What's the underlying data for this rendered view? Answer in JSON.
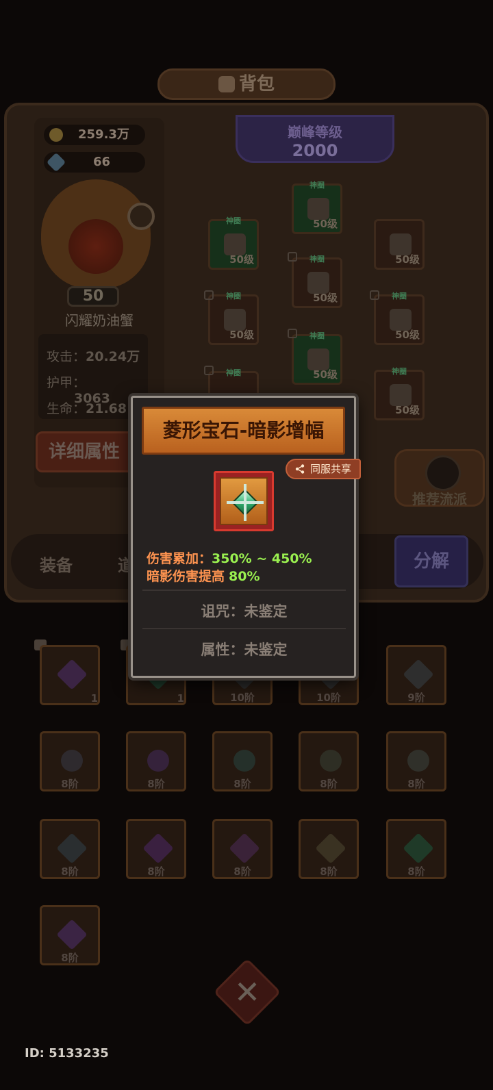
{
  "header": {
    "title": "背包"
  },
  "player": {
    "gold": "259.3万",
    "gems": "66",
    "level": "50",
    "name": "闪耀奶油蟹",
    "stats": [
      {
        "label": "攻击：",
        "value": "20.24万"
      },
      {
        "label": "护甲：",
        "value": "3063"
      },
      {
        "label": "生命：",
        "value": "21.68"
      }
    ],
    "detail_button": "详细属性"
  },
  "peak": {
    "label": "巅峰等级",
    "value": "2000"
  },
  "equipment": [
    {
      "tag": "神圈",
      "level": "50级",
      "green": true
    },
    {
      "tag": "神圈",
      "level": "50级",
      "green": true
    },
    {
      "tag": "",
      "level": "50级",
      "green": false
    },
    {
      "tag": "神圈",
      "level": "50级",
      "green": false
    },
    {
      "tag": "神圈",
      "level": "50级",
      "green": false
    },
    {
      "tag": "神圈",
      "level": "50级",
      "green": false
    },
    {
      "tag": "神圈",
      "level": "50级",
      "green": true
    },
    {
      "tag": "神圈",
      "level": "",
      "green": false
    },
    {
      "tag": "神圈",
      "level": "50级",
      "green": false
    }
  ],
  "recommend_label": "推荐流派",
  "tabs": [
    "装备",
    "道"
  ],
  "decompose_label": "分解",
  "inventory": [
    [
      "1",
      "1",
      "10阶",
      "10阶",
      "9阶"
    ],
    [
      "8阶",
      "8阶",
      "8阶",
      "8阶",
      "8阶"
    ],
    [
      "8阶",
      "8阶",
      "8阶",
      "8阶",
      "8阶"
    ],
    [
      "8阶"
    ]
  ],
  "player_id": "ID: 5133235",
  "popup": {
    "title": "菱形宝石-暗影增幅",
    "share_label": "同服共享",
    "stat1_label": "伤害累加：",
    "stat1_value": "350% ~ 450%",
    "stat2_label": "暗影伤害提高",
    "stat2_value": "80%",
    "curse": "诅咒：未鉴定",
    "attribute": "属性：未鉴定"
  },
  "colors": {
    "header_orange": "#d98a38",
    "stat_label": "#ff9450",
    "stat_value": "#9af050",
    "item_frame": "#d83a2f"
  }
}
